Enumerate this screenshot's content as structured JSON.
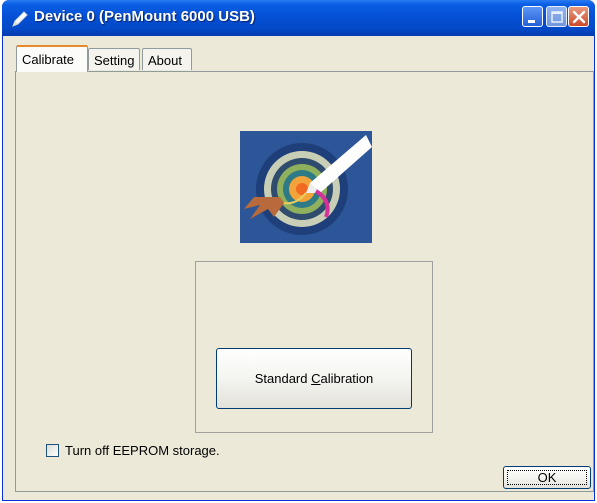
{
  "window": {
    "title": "Device 0 (PenMount 6000 USB)"
  },
  "titlebar_buttons": {
    "minimize_icon": "minimize-icon",
    "maximize_icon": "maximize-icon",
    "close_icon": "close-icon"
  },
  "tabs": [
    {
      "label": "Calibrate",
      "active": true
    },
    {
      "label": "Setting",
      "active": false
    },
    {
      "label": "About",
      "active": false
    }
  ],
  "calibrate": {
    "image_icon": "calibration-target-icon",
    "standard_button": {
      "before": "Standard ",
      "accel": "C",
      "after": "alibration"
    },
    "eeprom_checkbox": {
      "label": "Turn off EEPROM storage.",
      "checked": false
    }
  },
  "footer": {
    "ok_label": "OK"
  },
  "colors": {
    "titlebar": "#0550d6",
    "window_bg": "#ece9d8",
    "active_tab_accent": "#e68b2c"
  }
}
